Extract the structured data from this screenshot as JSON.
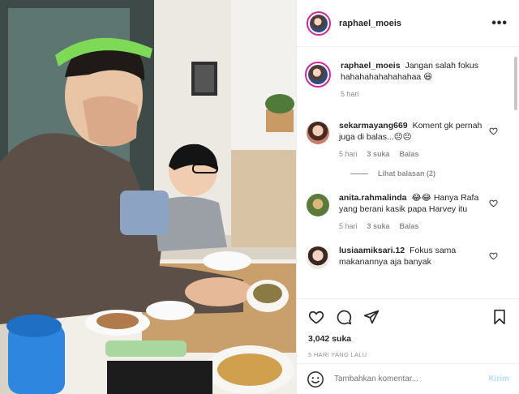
{
  "post": {
    "username": "raphael_moeis",
    "caption_user": "raphael_moeis",
    "caption_text": "Jangan salah fokus hahahahahahahahaa 😆",
    "caption_time": "5 hari",
    "more_icon": "more-options-icon"
  },
  "comments": [
    {
      "user": "sekarmayang669",
      "text": "Koment gk pernah juga di balas...😣😣",
      "time": "5 hari",
      "likes": "3 suka",
      "reply": "Balas",
      "view_replies": "Lihat balasan (2)"
    },
    {
      "user": "anita.rahmalinda",
      "text": "😂😂 Hanya Rafa yang berani kasik papa Harvey itu",
      "time": "5 hari",
      "likes": "3 suka",
      "reply": "Balas"
    },
    {
      "user": "lusiaamiksari.12",
      "text": "Fokus sama makanannya aja banyak"
    }
  ],
  "actions": {
    "like_count": "3,042 suka",
    "posted_when": "5 HARI YANG LALU",
    "icons": [
      "heart-icon",
      "comment-icon",
      "share-icon",
      "bookmark-icon"
    ]
  },
  "add_comment": {
    "placeholder": "Tambahkan komentar...",
    "post_label": "Kirim",
    "emoji_icon": "emoji-icon"
  },
  "colors": {
    "story_ring": "#d6249f",
    "secondary_text": "#8e8e8e",
    "post_button_disabled": "#b2dffc"
  }
}
